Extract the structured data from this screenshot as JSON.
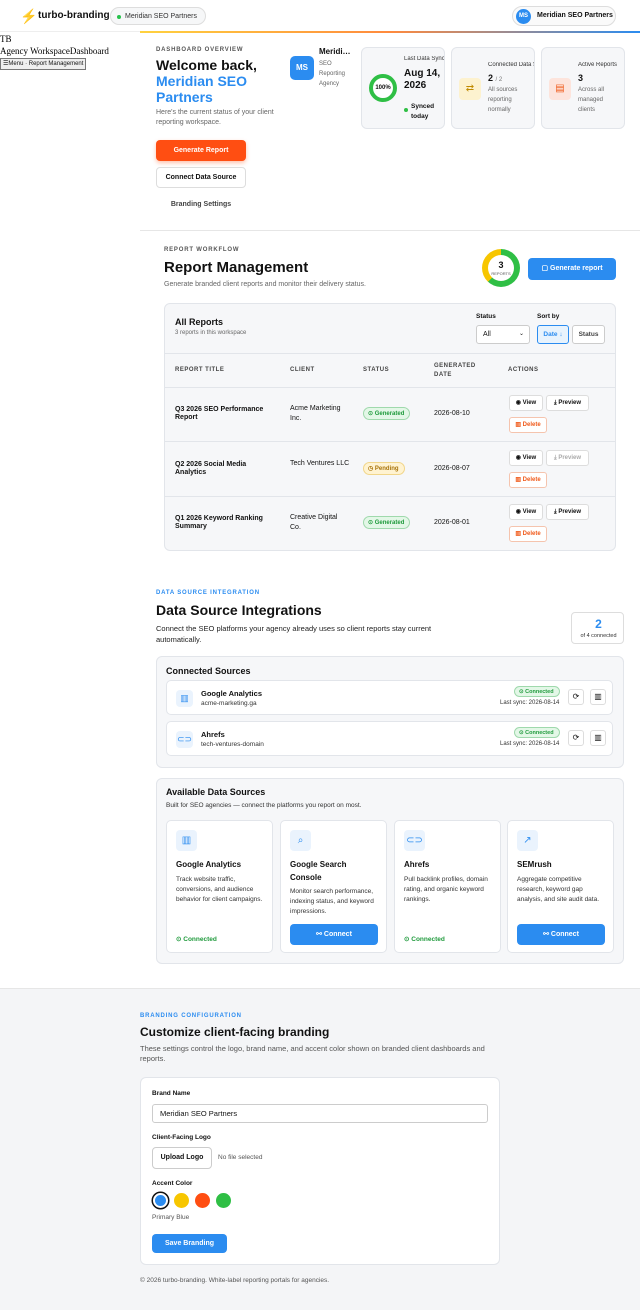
{
  "topbar": {
    "logo_icon": "bolt-icon",
    "app_name": "turbo-branding",
    "workspace_pill": "Meridian SEO Partners",
    "account_initials": "MS",
    "account_name": "Meridian SEO Partners"
  },
  "unstyled_nav": {
    "brand_abbr": "TB",
    "links": [
      "Agency Workspace",
      "Dashboard"
    ],
    "menu_button": "Menu · Report Management"
  },
  "overview": {
    "eyebrow": "DASHBOARD OVERVIEW",
    "welcome_prefix": "Welcome back,",
    "welcome_name": "Meridian SEO Partners",
    "subtitle": "Here's the current status of your client reporting workspace.",
    "generate_button": "Generate Report",
    "connect_button": "Connect Data Source",
    "branding_link": "Branding Settings",
    "agency_tile": {
      "initials": "MS",
      "name": "Meridi…",
      "type": "SEO Reporting Agency"
    },
    "stats": [
      {
        "label": "Last Data Sync",
        "ring_value": "100%",
        "ring_fraction": 1.0,
        "date": "Aug 14, 2026",
        "status": "Synced today"
      },
      {
        "label": "Connected Data Sources",
        "value": "2",
        "total": "/ 2",
        "note": "All sources reporting normally",
        "icon": "swap-icon"
      },
      {
        "label": "Active Reports",
        "value": "3",
        "note": "Across all managed clients",
        "icon": "report-icon"
      }
    ]
  },
  "reports": {
    "eyebrow": "REPORT WORKFLOW",
    "title": "Report Management",
    "subtitle": "Generate branded client reports and monitor their delivery status.",
    "donut_value": "3",
    "donut_label": "REPORTS",
    "generate_button": "Generate report",
    "panel_title": "All Reports",
    "panel_sub": "3 reports in this workspace",
    "status_label": "Status",
    "status_value": "All",
    "sort_label": "Sort by",
    "sort_options": [
      "Date ↓",
      "Status"
    ],
    "columns": [
      "REPORT TITLE",
      "CLIENT",
      "STATUS",
      "GENERATED DATE",
      "ACTIONS"
    ],
    "rows": [
      {
        "title": "Q3 2026 SEO Performance Report",
        "client": "Acme Marketing Inc.",
        "status": "Generated",
        "date": "2026-08-10",
        "view": "View",
        "preview": "Preview",
        "delete": "Delete"
      },
      {
        "title": "Q2 2026 Social Media Analytics",
        "client": "Tech Ventures LLC",
        "status": "Pending",
        "date": "2026-08-07",
        "view": "View",
        "preview": "Preview",
        "delete": "Delete"
      },
      {
        "title": "Q1 2026 Keyword Ranking Summary",
        "client": "Creative Digital Co.",
        "status": "Generated",
        "date": "2026-08-01",
        "view": "View",
        "preview": "Preview",
        "delete": "Delete"
      }
    ]
  },
  "integrations": {
    "eyebrow": "DATA SOURCE INTEGRATION",
    "title": "Data Source Integrations",
    "subtitle": "Connect the SEO platforms your agency already uses so client reports stay current automatically.",
    "count_value": "2",
    "count_label": "of 4 connected",
    "connected_title": "Connected Sources",
    "connected": [
      {
        "name": "Google Analytics",
        "account": "acme-marketing.ga",
        "status": "Connected",
        "sync": "Last sync: 2026-08-14",
        "icon": "bar-chart-icon"
      },
      {
        "name": "Ahrefs",
        "account": "tech-ventures-domain",
        "status": "Connected",
        "sync": "Last sync: 2026-08-14",
        "icon": "link-icon"
      }
    ],
    "available_title": "Available Data Sources",
    "available_sub": "Built for SEO agencies — connect the platforms you report on most.",
    "available": [
      {
        "name": "Google Analytics",
        "desc": "Track website traffic, conversions, and audience behavior for client campaigns.",
        "state": "Connected",
        "icon": "bar-chart-icon"
      },
      {
        "name": "Google Search Console",
        "desc": "Monitor search performance, indexing status, and keyword impressions.",
        "state": "Connect",
        "icon": "search-icon"
      },
      {
        "name": "Ahrefs",
        "desc": "Pull backlink profiles, domain rating, and organic keyword rankings.",
        "state": "Connected",
        "icon": "link-icon"
      },
      {
        "name": "SEMrush",
        "desc": "Aggregate competitive research, keyword gap analysis, and site audit data.",
        "state": "Connect",
        "icon": "trend-icon"
      }
    ]
  },
  "branding": {
    "eyebrow": "BRANDING CONFIGURATION",
    "title": "Customize client-facing branding",
    "subtitle": "These settings control the logo, brand name, and accent color shown on branded client dashboards and reports.",
    "brand_name_label": "Brand Name",
    "brand_name_value": "Meridian SEO Partners",
    "logo_label": "Client-Facing Logo",
    "upload_button": "Upload Logo",
    "no_file": "No file selected",
    "accent_label": "Accent Color",
    "colors": [
      "#2b8cf0",
      "#f7c600",
      "#ff4e12",
      "#2fbf45"
    ],
    "selected_color_name": "Primary Blue",
    "save_button": "Save Branding"
  },
  "footer": {
    "text": "© 2026 turbo-branding. White-label reporting portals for agencies."
  }
}
